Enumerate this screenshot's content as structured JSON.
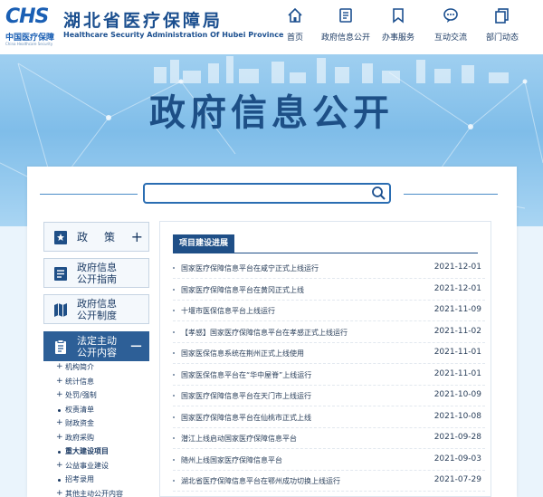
{
  "header": {
    "logo_mark": "CHS",
    "logo_sub": "中国医疗保障",
    "logo_tiny": "China Healthcare Security",
    "brand_cn": "湖北省医疗保障局",
    "brand_en": "Healthcare Security Administration Of Hubei Province"
  },
  "nav": [
    {
      "label": "首页",
      "icon": "home-icon"
    },
    {
      "label": "政府信息公开",
      "icon": "document-icon"
    },
    {
      "label": "办事服务",
      "icon": "bookmark-icon"
    },
    {
      "label": "互动交流",
      "icon": "chat-icon"
    },
    {
      "label": "部门动态",
      "icon": "copy-icon"
    }
  ],
  "banner": {
    "title": "政府信息公开"
  },
  "search": {
    "value": "",
    "placeholder": ""
  },
  "sidebar": {
    "items": [
      {
        "label": "政策",
        "icon": "star-doc-icon",
        "toggle": "+"
      },
      {
        "label_line1": "政府信息",
        "label_line2": "公开指南",
        "icon": "list-doc-icon"
      },
      {
        "label_line1": "政府信息",
        "label_line2": "公开制度",
        "icon": "map-icon"
      },
      {
        "label_line1": "法定主动",
        "label_line2": "公开内容",
        "icon": "clipboard-icon",
        "toggle": "−"
      }
    ],
    "sub_items": [
      {
        "label": "机构简介",
        "marker": "+"
      },
      {
        "label": "统计信息",
        "marker": "+"
      },
      {
        "label": "处罚/强制",
        "marker": "+"
      },
      {
        "label": "权责清单",
        "marker": "dot"
      },
      {
        "label": "财政资金",
        "marker": "+"
      },
      {
        "label": "政府采购",
        "marker": "+"
      },
      {
        "label": "重大建设项目",
        "marker": "dot",
        "active": true
      },
      {
        "label": "公益事业建设",
        "marker": "+"
      },
      {
        "label": "招考录用",
        "marker": "dot"
      },
      {
        "label": "其他主动公开内容",
        "marker": "+"
      }
    ]
  },
  "content": {
    "section_title": "项目建设进展",
    "rows": [
      {
        "title": "国家医疗保障信息平台在咸宁正式上线运行",
        "date": "2021-12-01"
      },
      {
        "title": "国家医疗保障信息平台在黄冈正式上线",
        "date": "2021-12-01"
      },
      {
        "title": "十堰市医保信息平台上线运行",
        "date": "2021-11-09"
      },
      {
        "title": "【孝感】国家医疗保障信息平台在孝感正式上线运行",
        "date": "2021-11-02"
      },
      {
        "title": "国家医保信息系统在荆州正式上线使用",
        "date": "2021-11-01"
      },
      {
        "title": "国家医保信息平台在“华中屋脊”上线运行",
        "date": "2021-11-01"
      },
      {
        "title": "国家医疗保障信息平台在天门市上线运行",
        "date": "2021-10-09"
      },
      {
        "title": "国家医疗保障信息平台在仙桃市正式上线",
        "date": "2021-10-08"
      },
      {
        "title": "潜江上线启动国家医疗保障信息平台",
        "date": "2021-09-28"
      },
      {
        "title": "随州上线国家医疗保障信息平台",
        "date": "2021-09-03"
      },
      {
        "title": "湖北省医疗保障信息平台在鄂州成功切换上线运行",
        "date": "2021-07-29"
      }
    ]
  }
}
